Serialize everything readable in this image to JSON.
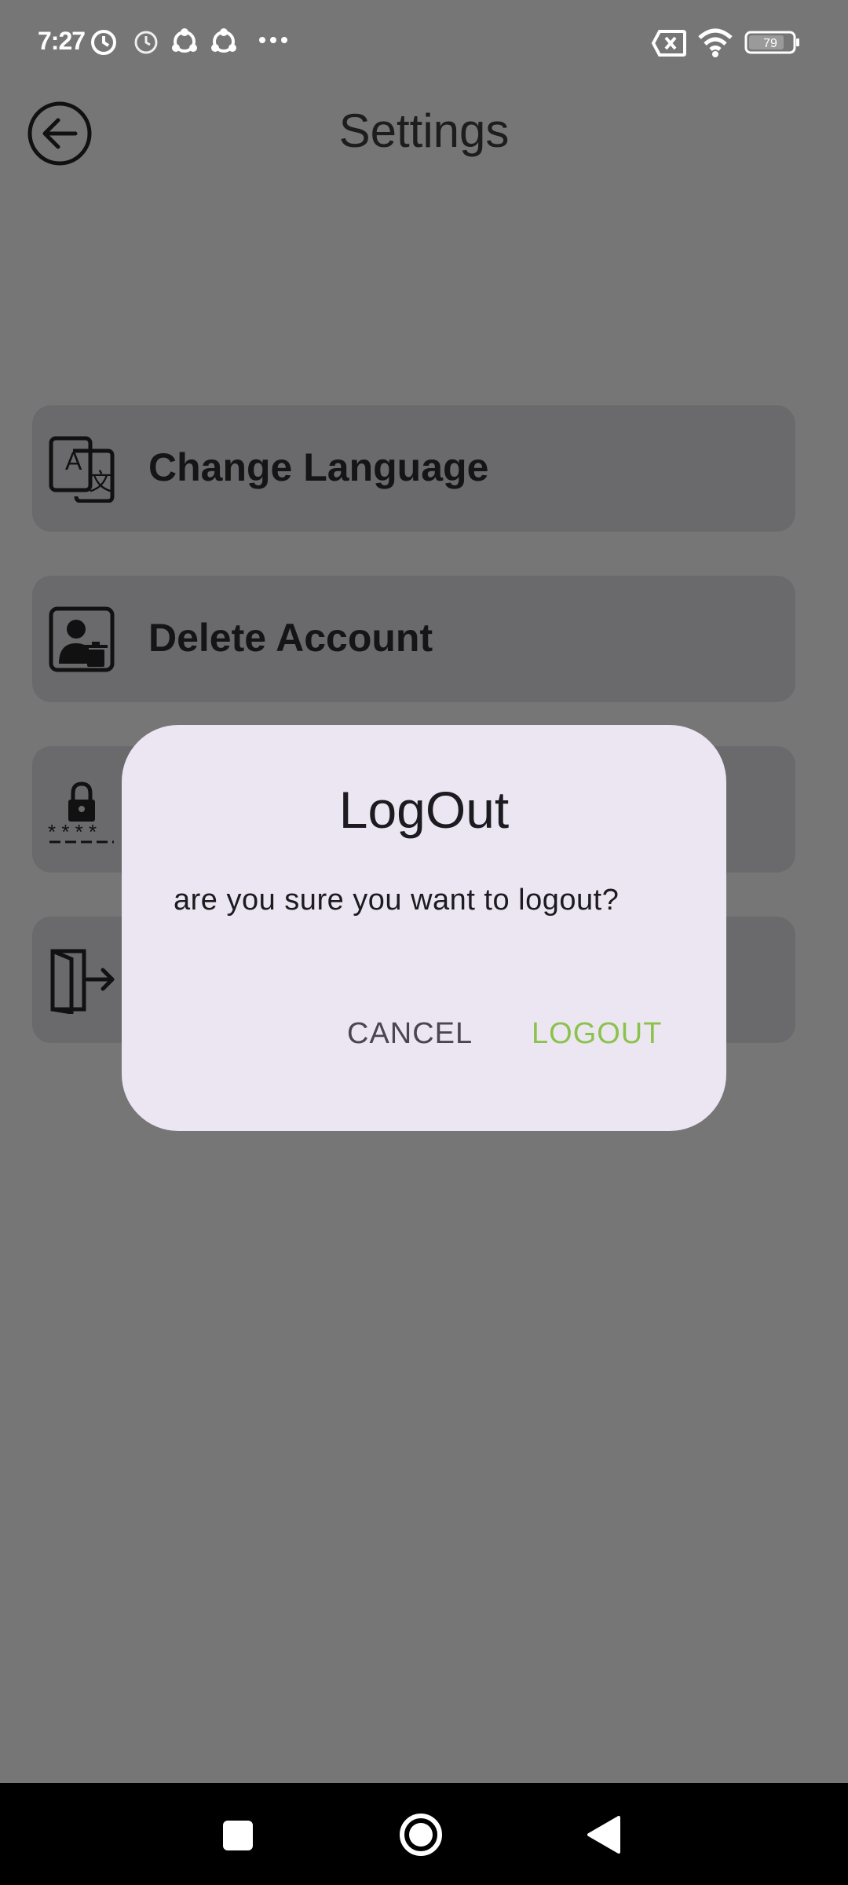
{
  "status_bar": {
    "time": "7:27",
    "battery": "79",
    "icons": [
      "alarm-icon",
      "alarm-icon",
      "share-icon",
      "share-icon",
      "more-icon",
      "no-sim-icon",
      "wifi-icon",
      "battery-icon"
    ]
  },
  "app_bar": {
    "title": "Settings",
    "back_icon": "back-arrow-icon"
  },
  "settings": {
    "items": [
      {
        "label": "Change Language",
        "icon": "translate-icon"
      },
      {
        "label": "Delete Account",
        "icon": "delete-account-icon"
      },
      {
        "label": "",
        "icon": "lock-password-icon"
      },
      {
        "label": "",
        "icon": "logout-icon"
      }
    ]
  },
  "dialog": {
    "title": "LogOut",
    "message": "are you sure you want to logout?",
    "cancel_label": "CANCEL",
    "confirm_label": "LOGOUT"
  },
  "colors": {
    "scrim_background": "#767676",
    "dialog_background": "#ece6f2",
    "confirm_accent": "#8bc34a",
    "navbar": "#000000"
  },
  "nav_bar": {
    "buttons": [
      "recents-icon",
      "home-icon",
      "back-icon"
    ]
  }
}
